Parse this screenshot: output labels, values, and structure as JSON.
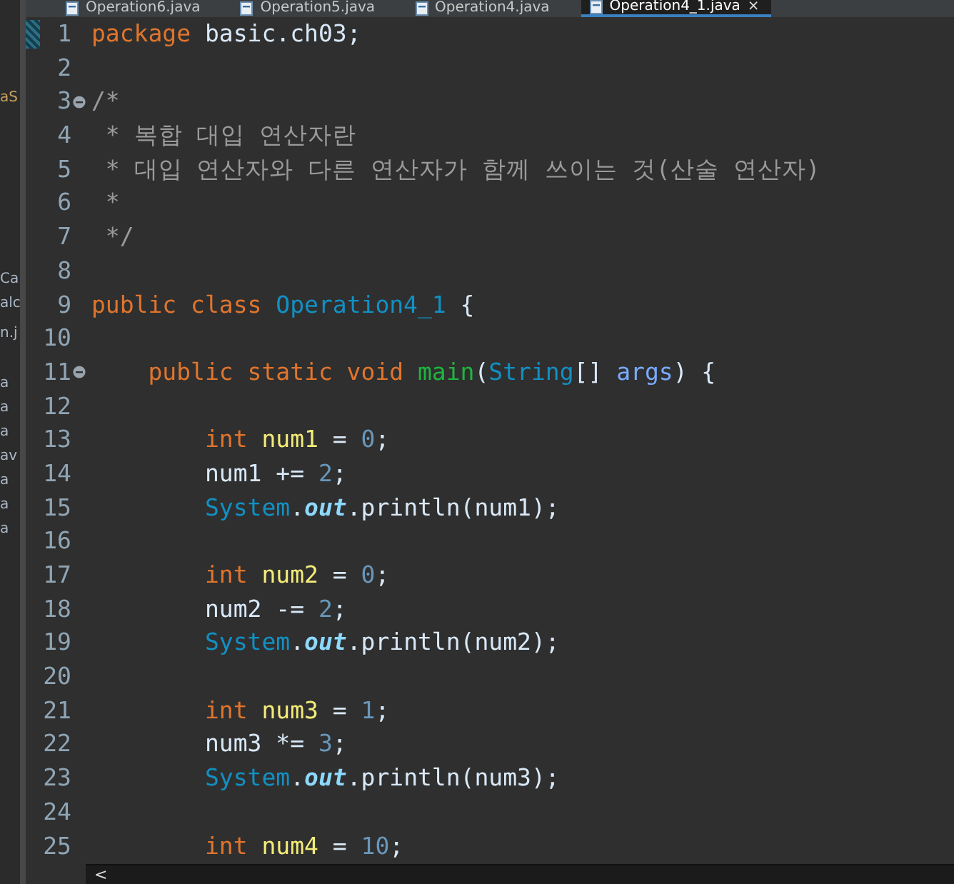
{
  "tabs": [
    {
      "label": "Operation6.java",
      "selected": false
    },
    {
      "label": "Operation5.java",
      "selected": false
    },
    {
      "label": "Operation4.java",
      "selected": false
    },
    {
      "label": "Operation4_1.java",
      "selected": true,
      "close": "×"
    }
  ],
  "sidebar": {
    "items": [
      {
        "text": "aS",
        "kind": "warn"
      },
      {
        "text": "Ca",
        "kind": "plain"
      },
      {
        "text": "alc",
        "kind": "plain"
      },
      {
        "text": "n.j",
        "kind": "plain"
      },
      {
        "text": "a",
        "kind": "plain"
      },
      {
        "text": "a",
        "kind": "plain"
      },
      {
        "text": "a",
        "kind": "plain"
      },
      {
        "text": "av",
        "kind": "plain"
      },
      {
        "text": "a",
        "kind": "plain"
      },
      {
        "text": "a",
        "kind": "plain"
      },
      {
        "text": "a",
        "kind": "plain"
      }
    ]
  },
  "editor": {
    "lines": [
      {
        "number": "1",
        "current": true,
        "tokens": [
          {
            "kind": "keyword",
            "text": "package"
          },
          {
            "kind": "plain",
            "text": " basic.ch03;"
          }
        ]
      },
      {
        "number": "2"
      },
      {
        "number": "3",
        "collapsible": true,
        "tokens": [
          {
            "kind": "comment",
            "text": "/*"
          }
        ]
      },
      {
        "number": "4",
        "tokens": [
          {
            "kind": "comment",
            "text": " * 복합 대입 연산자란"
          }
        ]
      },
      {
        "number": "5",
        "tokens": [
          {
            "kind": "comment",
            "text": " * 대입 연산자와 다른 연산자가 함께 쓰이는 것(산술 연산자)"
          }
        ]
      },
      {
        "number": "6",
        "tokens": [
          {
            "kind": "comment",
            "text": " *"
          }
        ]
      },
      {
        "number": "7",
        "tokens": [
          {
            "kind": "comment",
            "text": " */"
          }
        ]
      },
      {
        "number": "8"
      },
      {
        "number": "9",
        "tokens": [
          {
            "kind": "keyword",
            "text": "public class"
          },
          {
            "kind": "type",
            "text": " Operation4_1"
          },
          {
            "kind": "plain",
            "text": " {"
          }
        ]
      },
      {
        "number": "10"
      },
      {
        "number": "11",
        "collapsible": true,
        "tokens": [
          {
            "kind": "keyword",
            "text": "    public static void"
          },
          {
            "kind": "method",
            "text": " main"
          },
          {
            "kind": "plain",
            "text": "("
          },
          {
            "kind": "type",
            "text": "String"
          },
          {
            "kind": "plain",
            "text": "[]"
          },
          {
            "kind": "param",
            "text": " args"
          },
          {
            "kind": "plain",
            "text": ") {"
          }
        ]
      },
      {
        "number": "12"
      },
      {
        "number": "13",
        "tokens": [
          {
            "kind": "keyword",
            "text": "        int"
          },
          {
            "kind": "variable",
            "text": " num1"
          },
          {
            "kind": "plain",
            "text": " ="
          },
          {
            "kind": "number",
            "text": " 0"
          },
          {
            "kind": "plain",
            "text": ";"
          }
        ]
      },
      {
        "number": "14",
        "tokens": [
          {
            "kind": "plain",
            "text": "        num1 +="
          },
          {
            "kind": "number",
            "text": " 2"
          },
          {
            "kind": "plain",
            "text": ";"
          }
        ]
      },
      {
        "number": "15",
        "tokens": [
          {
            "kind": "type",
            "text": "        System"
          },
          {
            "kind": "plain",
            "text": "."
          },
          {
            "kind": "field",
            "text": "out"
          },
          {
            "kind": "plain",
            "text": ".println(num1);"
          }
        ]
      },
      {
        "number": "16"
      },
      {
        "number": "17",
        "tokens": [
          {
            "kind": "keyword",
            "text": "        int"
          },
          {
            "kind": "variable",
            "text": " num2"
          },
          {
            "kind": "plain",
            "text": " ="
          },
          {
            "kind": "number",
            "text": " 0"
          },
          {
            "kind": "plain",
            "text": ";"
          }
        ]
      },
      {
        "number": "18",
        "tokens": [
          {
            "kind": "plain",
            "text": "        num2 -="
          },
          {
            "kind": "number",
            "text": " 2"
          },
          {
            "kind": "plain",
            "text": ";"
          }
        ]
      },
      {
        "number": "19",
        "tokens": [
          {
            "kind": "type",
            "text": "        System"
          },
          {
            "kind": "plain",
            "text": "."
          },
          {
            "kind": "field",
            "text": "out"
          },
          {
            "kind": "plain",
            "text": ".println(num2);"
          }
        ]
      },
      {
        "number": "20"
      },
      {
        "number": "21",
        "tokens": [
          {
            "kind": "keyword",
            "text": "        int"
          },
          {
            "kind": "variable",
            "text": " num3"
          },
          {
            "kind": "plain",
            "text": " ="
          },
          {
            "kind": "number",
            "text": " 1"
          },
          {
            "kind": "plain",
            "text": ";"
          }
        ]
      },
      {
        "number": "22",
        "tokens": [
          {
            "kind": "plain",
            "text": "        num3 *="
          },
          {
            "kind": "number",
            "text": " 3"
          },
          {
            "kind": "plain",
            "text": ";"
          }
        ]
      },
      {
        "number": "23",
        "tokens": [
          {
            "kind": "type",
            "text": "        System"
          },
          {
            "kind": "plain",
            "text": "."
          },
          {
            "kind": "field",
            "text": "out"
          },
          {
            "kind": "plain",
            "text": ".println(num3);"
          }
        ]
      },
      {
        "number": "24"
      },
      {
        "number": "25",
        "tokens": [
          {
            "kind": "keyword",
            "text": "        int"
          },
          {
            "kind": "variable",
            "text": " num4"
          },
          {
            "kind": "plain",
            "text": " ="
          },
          {
            "kind": "number",
            "text": " 10"
          },
          {
            "kind": "plain",
            "text": ";"
          }
        ]
      }
    ]
  },
  "scrollbar": {
    "arrow": "<"
  }
}
